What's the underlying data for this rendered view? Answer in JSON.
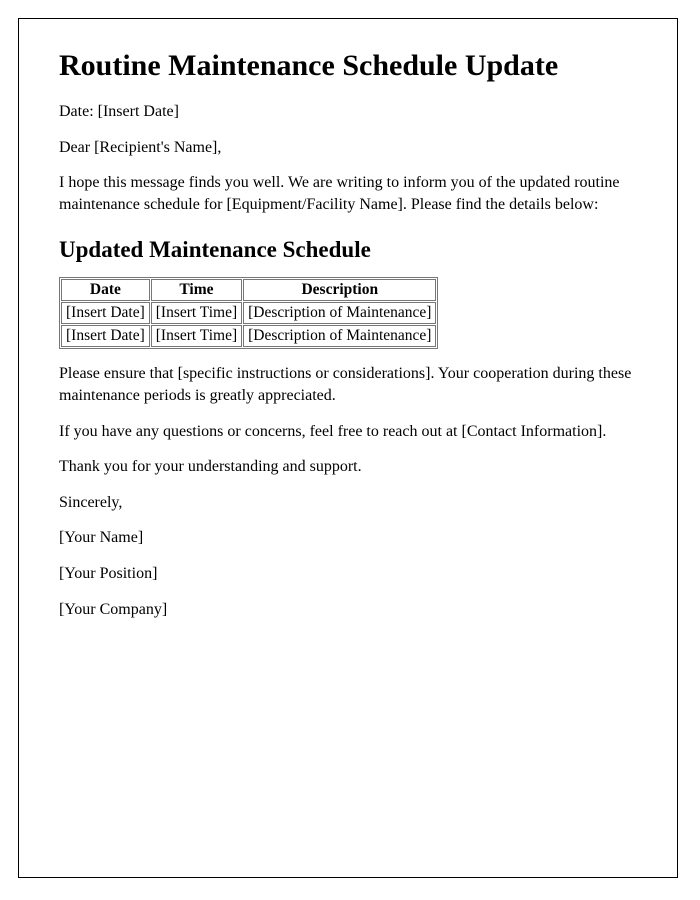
{
  "title": "Routine Maintenance Schedule Update",
  "date_line": "Date: [Insert Date]",
  "greeting": "Dear [Recipient's Name],",
  "intro": "I hope this message finds you well. We are writing to inform you of the updated routine maintenance schedule for [Equipment/Facility Name]. Please find the details below:",
  "subheading": "Updated Maintenance Schedule",
  "table": {
    "headers": {
      "date": "Date",
      "time": "Time",
      "desc": "Description"
    },
    "rows": [
      {
        "date": "[Insert Date]",
        "time": "[Insert Time]",
        "desc": "[Description of Maintenance]"
      },
      {
        "date": "[Insert Date]",
        "time": "[Insert Time]",
        "desc": "[Description of Maintenance]"
      }
    ]
  },
  "instructions": "Please ensure that [specific instructions or considerations]. Your cooperation during these maintenance periods is greatly appreciated.",
  "contact": "If you have any questions or concerns, feel free to reach out at [Contact Information].",
  "thanks": "Thank you for your understanding and support.",
  "closing": "Sincerely,",
  "sender_name": "[Your Name]",
  "sender_position": "[Your Position]",
  "sender_company": "[Your Company]"
}
